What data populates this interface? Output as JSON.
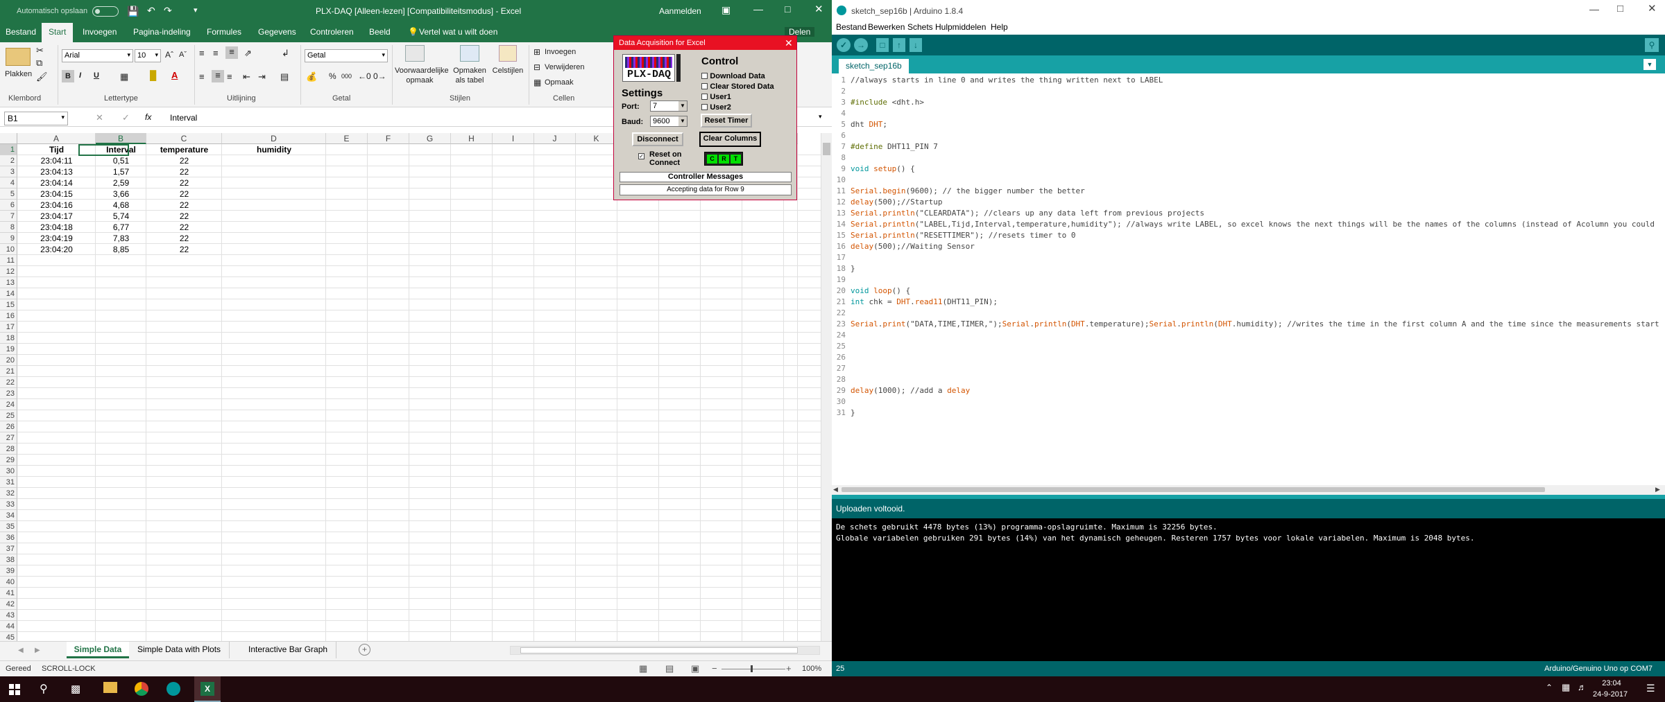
{
  "excel": {
    "autosave_label": "Automatisch opslaan",
    "autosave_state": "Uit",
    "title": "PLX-DAQ [Alleen-lezen] [Compatibiliteitsmodus] - Excel",
    "signin": "Aanmelden",
    "tabs": [
      "Bestand",
      "Start",
      "Invoegen",
      "Pagina-indeling",
      "Formules",
      "Gegevens",
      "Controleren",
      "Beeld"
    ],
    "tell_me": "Vertel wat u wilt doen",
    "share": "Delen",
    "ribbon": {
      "paste": "Plakken",
      "font_name": "Arial",
      "font_size": "10",
      "number_format": "Getal",
      "cond_format_1": "Voorwaardelijke",
      "cond_format_2": "opmaak",
      "format_table_1": "Opmaken",
      "format_table_2": "als tabel",
      "cell_styles": "Celstijlen",
      "insert": "Invoegen",
      "delete": "Verwijderen",
      "format": "Opmaak",
      "groups": [
        "Klembord",
        "Lettertype",
        "Uitlijning",
        "Getal",
        "Stijlen",
        "Cellen"
      ],
      "bold": "B",
      "italic": "I",
      "underline": "U",
      "percent": "%",
      "thousands": "000"
    },
    "name_box": "B1",
    "formula_content": "Interval",
    "columns": [
      "A",
      "B",
      "C",
      "D",
      "E",
      "F",
      "G",
      "H",
      "I",
      "J",
      "K",
      "L",
      "M",
      "N",
      "O",
      "P"
    ],
    "rows": [
      "1",
      "2",
      "3",
      "4",
      "5",
      "6",
      "7",
      "8",
      "9",
      "10",
      "11",
      "12",
      "13",
      "14",
      "15",
      "16",
      "17",
      "18",
      "19",
      "20",
      "21",
      "22",
      "23",
      "24",
      "25",
      "26",
      "27",
      "28",
      "29",
      "30",
      "31",
      "32",
      "33",
      "34",
      "35",
      "36",
      "37",
      "38",
      "39",
      "40",
      "41",
      "42",
      "43",
      "44",
      "45"
    ],
    "headers": [
      "Tijd",
      "Interval",
      "temperature",
      "humidity"
    ],
    "data": [
      [
        "23:04:11",
        "0,51",
        "22"
      ],
      [
        "23:04:13",
        "1,57",
        "22"
      ],
      [
        "23:04:14",
        "2,59",
        "22"
      ],
      [
        "23:04:15",
        "3,66",
        "22"
      ],
      [
        "23:04:16",
        "4,68",
        "22"
      ],
      [
        "23:04:17",
        "5,74",
        "22"
      ],
      [
        "23:04:18",
        "6,77",
        "22"
      ],
      [
        "23:04:19",
        "7,83",
        "22"
      ],
      [
        "23:04:20",
        "8,85",
        "22"
      ]
    ],
    "sheets": [
      "Simple Data",
      "Simple Data with Plots",
      "Interactive Bar Graph"
    ],
    "status_ready": "Gereed",
    "status_scroll": "SCROLL-LOCK",
    "zoom": "100%"
  },
  "plx": {
    "title": "Data Acquisition for Excel",
    "logo": "PLX-DAQ",
    "settings_heading": "Settings",
    "control_heading": "Control",
    "port_label": "Port:",
    "port_value": "7",
    "baud_label": "Baud:",
    "baud_value": "9600",
    "checkboxes": [
      "Download Data",
      "Clear Stored Data",
      "User1",
      "User2"
    ],
    "reset_timer": "Reset Timer",
    "disconnect": "Disconnect",
    "clear_columns": "Clear Columns",
    "reset_on_connect": "Reset on Connect",
    "indicators": [
      "C",
      "R",
      "T"
    ],
    "controller_messages": "Controller Messages",
    "status_message": "Accepting data for Row 9"
  },
  "arduino": {
    "title": "sketch_sep16b | Arduino 1.8.4",
    "menu": [
      "Bestand",
      "Bewerken",
      "Schets",
      "Hulpmiddelen",
      "Help"
    ],
    "tab_name": "sketch_sep16b",
    "code_lines": [
      "//always starts in line 0 and writes the thing written next to LABEL",
      "",
      "#include <dht.h>",
      "",
      "dht DHT;",
      "",
      "#define DHT11_PIN 7",
      "",
      "void setup() {",
      "",
      "Serial.begin(9600); // the bigger number the better",
      "delay(500);//Startup",
      "Serial.println(\"CLEARDATA\"); //clears up any data left from previous projects",
      "Serial.println(\"LABEL,Tijd,Interval,temperature,humidity\"); //always write LABEL, so excel knows the next things will be the names of the columns (instead of Acolumn you could",
      "Serial.println(\"RESETTIMER\"); //resets timer to 0",
      "delay(500);//Waiting Sensor",
      "",
      "}",
      "",
      "void loop() {",
      "int chk = DHT.read11(DHT11_PIN);",
      "",
      "Serial.print(\"DATA,TIME,TIMER,\");Serial.println(DHT.temperature);Serial.println(DHT.humidity); //writes the time in the first column A and the time since the measurements start",
      "",
      "",
      "",
      "",
      "",
      "delay(1000); //add a delay",
      "",
      "}"
    ],
    "status": "Uploaden voltooid.",
    "console": [
      "De schets gebruikt 4478 bytes (13%)  programma-opslagruimte. Maximum is 32256 bytes.",
      "Globale variabelen gebruiken 291 bytes (14%) van het dynamisch geheugen. Resteren 1757 bytes voor lokale variabelen. Maximum is 2048 bytes."
    ],
    "line_indicator": "25",
    "board": "Arduino/Genuino Uno op COM7"
  },
  "taskbar": {
    "time": "23:04",
    "date": "24-9-2017"
  },
  "colors": {
    "excel_green": "#217346",
    "arduino_teal": "#006468",
    "arduino_tab": "#17a1a5",
    "plx_red": "#e81123"
  }
}
